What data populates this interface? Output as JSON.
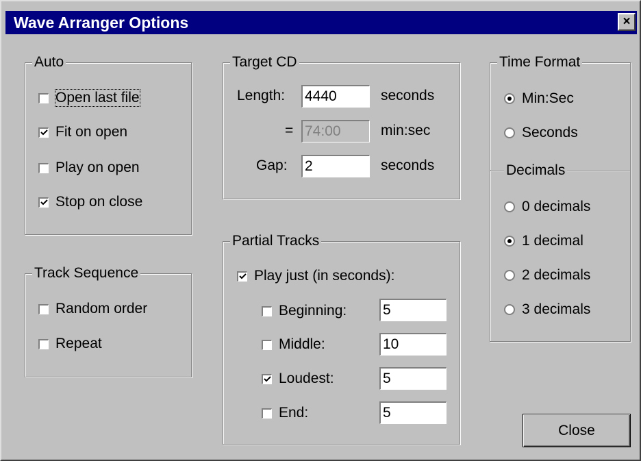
{
  "window": {
    "title": "Wave Arranger Options",
    "close_glyph": "×"
  },
  "auto": {
    "legend": "Auto",
    "items": [
      {
        "label": "Open last file",
        "checked": false
      },
      {
        "label": "Fit on open",
        "checked": true
      },
      {
        "label": "Play on open",
        "checked": false
      },
      {
        "label": "Stop on close",
        "checked": true
      }
    ]
  },
  "track_sequence": {
    "legend": "Track Sequence",
    "items": [
      {
        "label": "Random order",
        "checked": false
      },
      {
        "label": "Repeat",
        "checked": false
      }
    ]
  },
  "target_cd": {
    "legend": "Target CD",
    "length_label": "Length:",
    "length_value": "4440",
    "length_unit": "seconds",
    "equals": "=",
    "minsec_value": "74:00",
    "minsec_unit": "min:sec",
    "gap_label": "Gap:",
    "gap_value": "2",
    "gap_unit": "seconds"
  },
  "partial_tracks": {
    "legend": "Partial Tracks",
    "play_just": {
      "label": "Play just (in seconds):",
      "checked": true
    },
    "items": [
      {
        "label": "Beginning:",
        "checked": false,
        "value": "5"
      },
      {
        "label": "Middle:",
        "checked": false,
        "value": "10"
      },
      {
        "label": "Loudest:",
        "checked": true,
        "value": "5"
      },
      {
        "label": "End:",
        "checked": false,
        "value": "5"
      }
    ]
  },
  "time_format": {
    "legend": "Time Format",
    "options": [
      {
        "label": "Min:Sec",
        "selected": true
      },
      {
        "label": "Seconds",
        "selected": false
      }
    ]
  },
  "decimals": {
    "legend": "Decimals",
    "options": [
      {
        "label": "0 decimals",
        "selected": false
      },
      {
        "label": "1 decimal",
        "selected": true
      },
      {
        "label": "2 decimals",
        "selected": false
      },
      {
        "label": "3 decimals",
        "selected": false
      }
    ]
  },
  "close_button": {
    "label": "Close"
  }
}
